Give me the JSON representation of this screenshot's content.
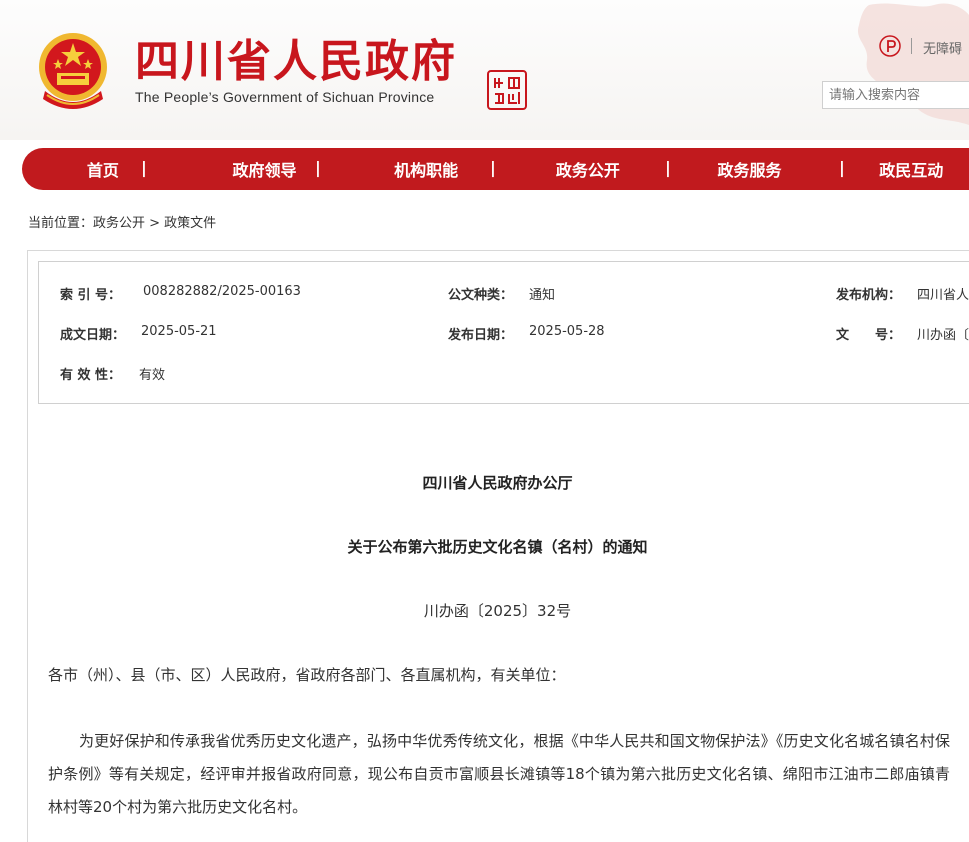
{
  "header": {
    "site_title": "四川省人民政府",
    "site_subtitle": "The People’s Government of Sichuan Province",
    "seal_text": "中國四川",
    "accessibility_link": "无障碍",
    "search_placeholder": "请输入搜索内容",
    "brand_color": "#c8161d"
  },
  "nav": {
    "items": [
      "首页",
      "政府领导",
      "机构职能",
      "政务公开",
      "政务服务",
      "政民互动"
    ],
    "separator": "|",
    "bg_color": "#c11a1e"
  },
  "breadcrumb": {
    "prefix": "当前位置：",
    "path": "政务公开 > 政策文件"
  },
  "meta": {
    "index_label": "索 引 号：",
    "index_value": "008282882/2025-00163",
    "doc_type_label": "公文种类：",
    "doc_type_value": "通知",
    "issuer_label": "发布机构：",
    "issuer_value": "四川省人",
    "created_label": "成文日期：",
    "created_value": "2025-05-21",
    "published_label": "发布日期：",
    "published_value": "2025-05-28",
    "doc_no_label": "文　　号：",
    "doc_no_value": "川办函〔",
    "validity_label": "有 效 性：",
    "validity_value": "有效"
  },
  "document": {
    "org": "四川省人民政府办公厅",
    "title": "关于公布第六批历史文化名镇（名村）的通知",
    "number": "川办函〔2025〕32号",
    "addressee": "各市（州）、县（市、区）人民政府，省政府各部门、各直属机构，有关单位：",
    "paragraph": "为更好保护和传承我省优秀历史文化遗产，弘扬中华优秀传统文化，根据《中华人民共和国文物保护法》《历史文化名城名镇名村保护条例》等有关规定，经评审并报省政府同意，现公布自贡市富顺县长滩镇等18个镇为第六批历史文化名镇、绵阳市江油市二郎庙镇青林村等20个村为第六批历史文化名村。"
  }
}
